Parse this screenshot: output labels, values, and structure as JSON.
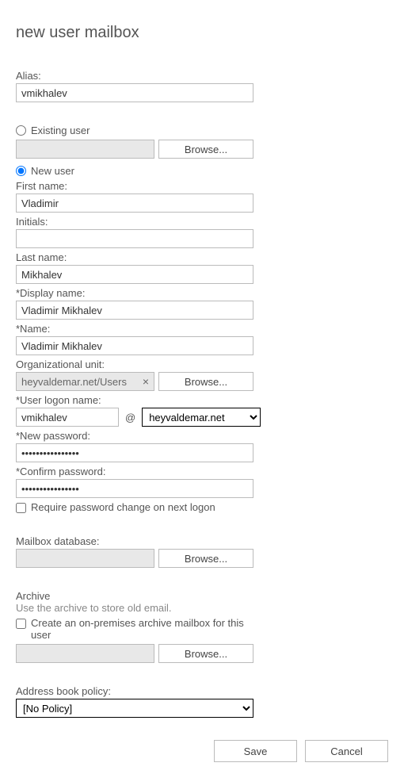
{
  "title": "new user mailbox",
  "labels": {
    "alias": "Alias:",
    "existing_user": "Existing user",
    "new_user": "New user",
    "first_name": "First name:",
    "initials": "Initials:",
    "last_name": "Last name:",
    "display_name": "*Display name:",
    "name": "*Name:",
    "org_unit": "Organizational unit:",
    "user_logon": "*User logon name:",
    "at": "@",
    "new_password": "*New password:",
    "confirm_password": "*Confirm password:",
    "require_pw_change": "Require password change on next logon",
    "mailbox_db": "Mailbox database:",
    "archive": "Archive",
    "archive_help": "Use the archive to store old email.",
    "create_archive": "Create an on-premises archive mailbox for this user",
    "abp": "Address book policy:",
    "browse": "Browse...",
    "save": "Save",
    "cancel": "Cancel"
  },
  "values": {
    "alias": "vmikhalev",
    "existing_user_display": "",
    "first_name": "Vladimir",
    "initials": "",
    "last_name": "Mikhalev",
    "display_name": "Vladimir Mikhalev",
    "name": "Vladimir Mikhalev",
    "org_unit": "heyvaldemar.net/Users",
    "user_logon": "vmikhalev",
    "domain_selected": "heyvaldemar.net",
    "new_password": "••••••••••••••••",
    "confirm_password": "••••••••••••••••",
    "require_pw_change": false,
    "mailbox_db": "",
    "create_archive": false,
    "archive_location": "",
    "abp_selected": "[No Policy]"
  },
  "radio": {
    "selected": "new"
  },
  "icons": {
    "clear": "×"
  }
}
